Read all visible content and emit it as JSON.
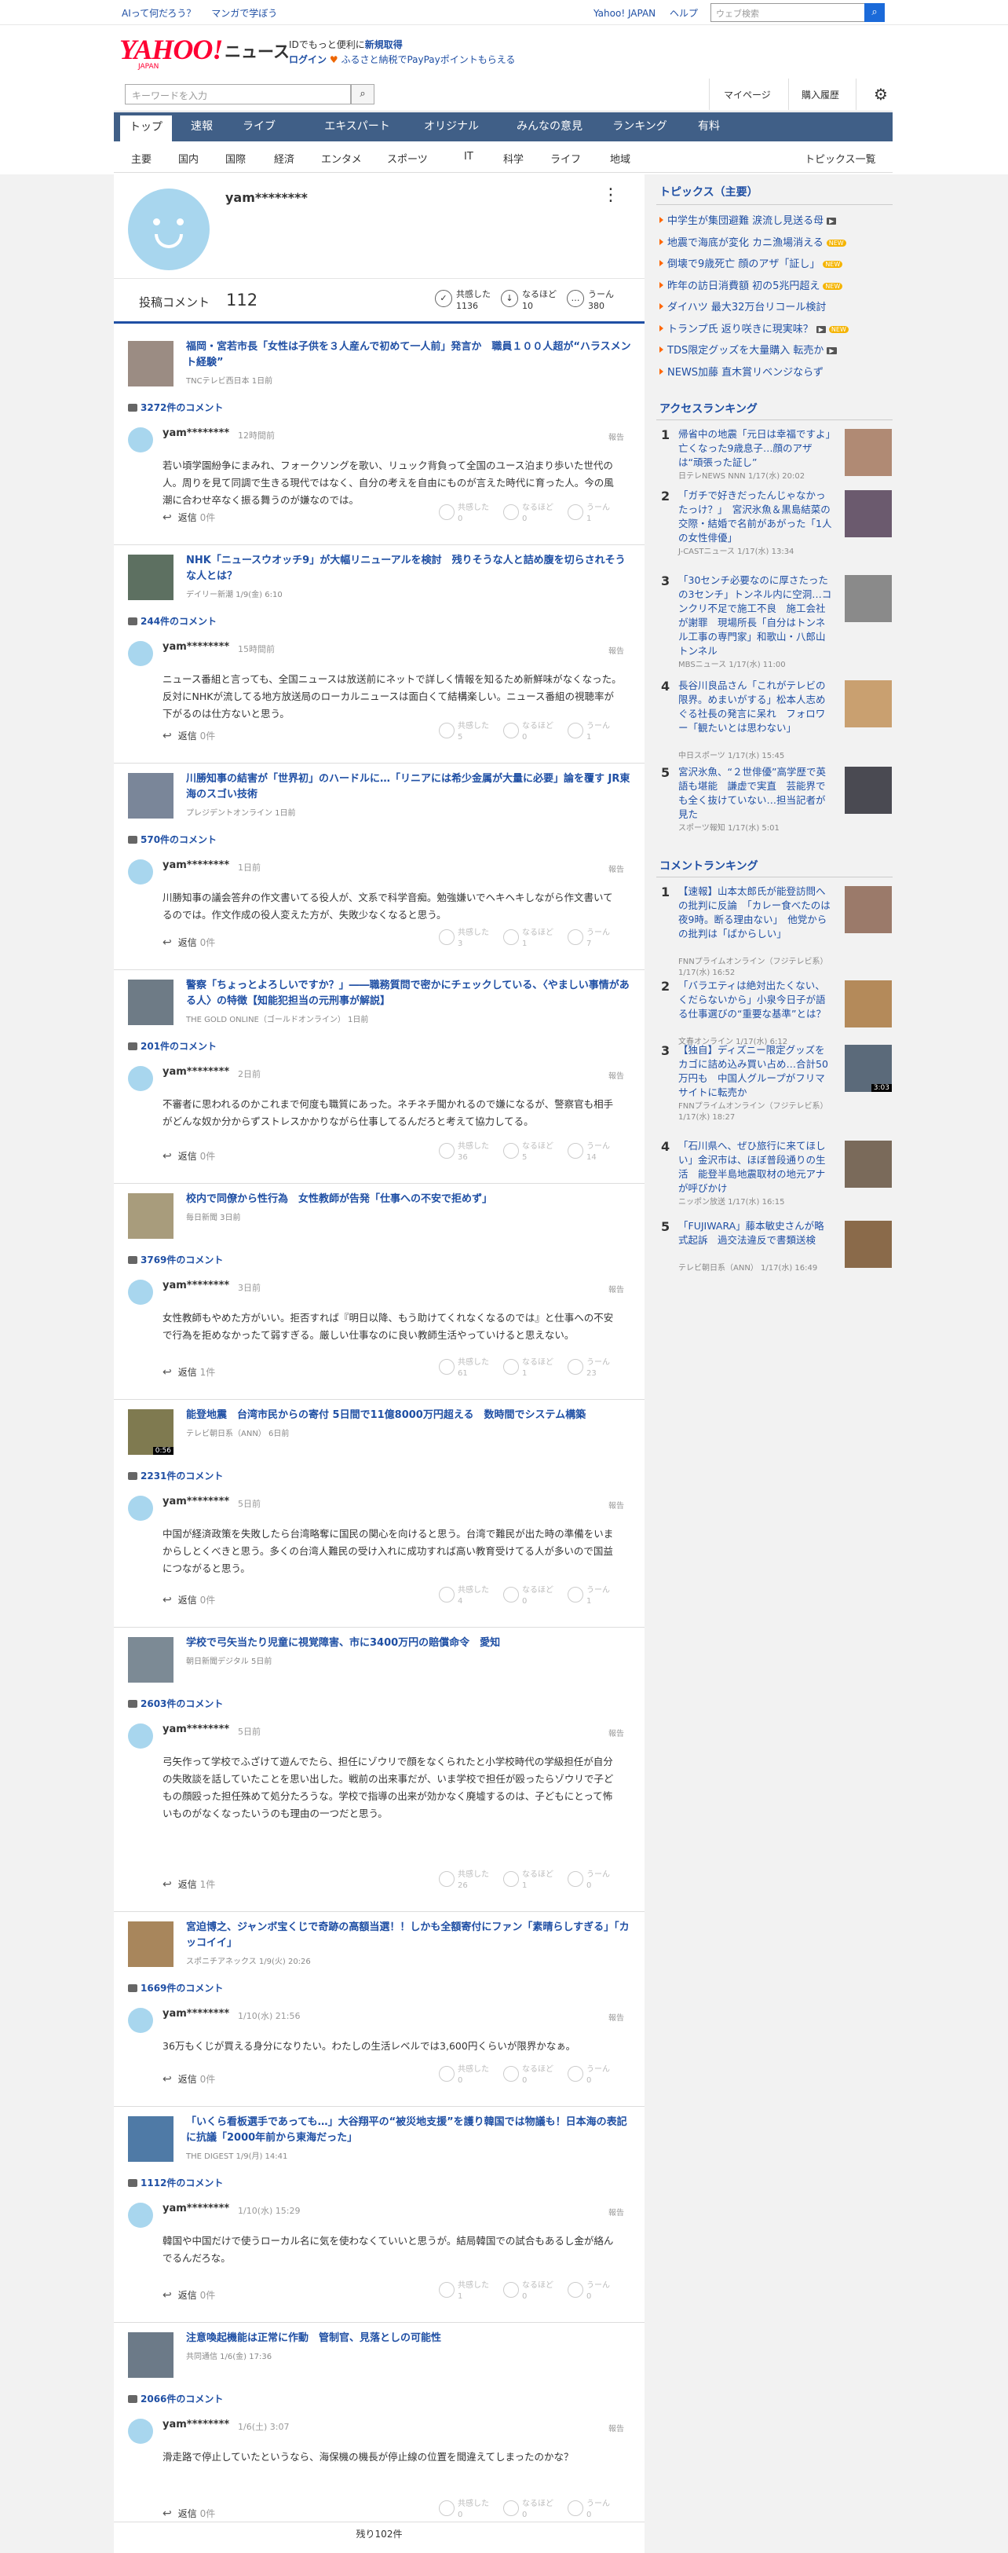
{
  "topbar": {
    "links": [
      "AIって何だろう？",
      "マンガで学ぼう"
    ],
    "right": [
      "Yahoo! JAPAN",
      "ヘルプ"
    ],
    "search_placeholder": "ウェブ検索"
  },
  "header": {
    "logo": "YAHOO!",
    "logo_sub": "JAPAN",
    "title": "ニュース",
    "promo_line1_a": "IDでもっと便利に",
    "promo_line1_b": "新規取得",
    "promo_line2_a": "ログイン",
    "promo_line2_b": "ふるさと納税でPayPayポイントもらえる"
  },
  "search": {
    "placeholder": "キーワードを入力",
    "mypage": "マイページ",
    "purchase": "購入履歴"
  },
  "nav": [
    "トップ",
    "速報",
    "ライブ",
    "エキスパート",
    "オリジナル",
    "みんなの意見",
    "ランキング",
    "有料"
  ],
  "subnav": [
    "主要",
    "国内",
    "国際",
    "経済",
    "エンタメ",
    "スポーツ",
    "IT",
    "科学",
    "ライフ",
    "地域"
  ],
  "subnav_right": "トピックス一覧",
  "profile": {
    "username": "yam********",
    "stat_label": "投稿コメント",
    "stat_count": "112",
    "reactions": [
      {
        "label": "共感した",
        "count": "1136",
        "icon": "✓"
      },
      {
        "label": "なるほど",
        "count": "10",
        "icon": "↓"
      },
      {
        "label": "うーん",
        "count": "380",
        "icon": "…"
      }
    ]
  },
  "comments": [
    {
      "title": "福岡・宮若市長「女性は子供を３人産んで初めて一人前」発言か　職員１００人超が“ハラスメント経験”",
      "source": "TNCテレビ西日本 1日前",
      "count": "3272件のコメント",
      "user": "yam********",
      "time": "12時間前",
      "report": "報告",
      "text": "若い頃学園紛争にまみれ、フォークソングを歌い、リュック背負って全国のユース泊まり歩いた世代の人。周りを見て同調で生きる現代ではなく、自分の考えを自由にものが言えた時代に育った人。今の風潮に合わせ卒なく振る舞うのが嫌なのでは。",
      "reply": "返信",
      "reply_n": "0件",
      "r1": "共感した",
      "n1": "0",
      "r2": "なるほど",
      "n2": "0",
      "r3": "うーん",
      "n3": "1"
    },
    {
      "title": "NHK「ニュースウオッチ9」が大幅リニューアルを検討　残りそうな人と詰め腹を切らされそうな人とは？",
      "source": "デイリー新潮 1/9(金) 6:10",
      "count": "244件のコメント",
      "user": "yam********",
      "time": "15時間前",
      "report": "報告",
      "text": "ニュース番組と言っても、全国ニュースは放送前にネットで詳しく情報を知るため新鮮味がなくなった。反対にNHKが流してる地方放送局のローカルニュースは面白くて結構楽しい。ニュース番組の視聴率が下がるのは仕方ないと思う。",
      "reply": "返信",
      "reply_n": "0件",
      "r1": "共感した",
      "n1": "5",
      "r2": "なるほど",
      "n2": "0",
      "r3": "うーん",
      "n3": "1"
    },
    {
      "title": "川勝知事の結害が「世界初」のハードルに…「リニアには希少金属が大量に必要」論を覆す JR東海のスゴい技術",
      "source": "プレジデントオンライン 1日前",
      "count": "570件のコメント",
      "user": "yam********",
      "time": "1日前",
      "report": "報告",
      "text": "川勝知事の議会答弁の作文書いてる役人が、文系で科学音痴。勉強嫌いでヘキヘキしながら作文書いてるのでは。作文作成の役人変えた方が、失敗少なくなると思う。",
      "reply": "返信",
      "reply_n": "0件",
      "r1": "共感した",
      "n1": "3",
      "r2": "なるほど",
      "n2": "1",
      "r3": "うーん",
      "n3": "7"
    },
    {
      "title": "警察「ちょっとよろしいですか？」――職務質問で密かにチェックしている、〈やましい事情がある人〉の特徴【知能犯担当の元刑事が解説】",
      "source": "THE GOLD ONLINE（ゴールドオンライン） 1日前",
      "count": "201件のコメント",
      "user": "yam********",
      "time": "2日前",
      "report": "報告",
      "text": "不審者に思われるのかこれまで何度も職質にあった。ネチネチ聞かれるので嫌になるが、警察官も相手がどんな奴か分からずストレスかかりながら仕事してるんだろと考えて協力してる。",
      "reply": "返信",
      "reply_n": "0件",
      "r1": "共感した",
      "n1": "36",
      "r2": "なるほど",
      "n2": "5",
      "r3": "うーん",
      "n3": "14"
    },
    {
      "title": "校内で同僚から性行為　女性教師が告発「仕事への不安で拒めず」",
      "source": "毎日新聞 3日前",
      "count": "3769件のコメント",
      "user": "yam********",
      "time": "3日前",
      "report": "報告",
      "text": "女性教師もやめた方がいい。拒否すれば『明日以降、もう助けてくれなくなるのでは』と仕事への不安で行為を拒めなかったて弱すぎる。厳しい仕事なのに良い教師生活やっていけると思えない。",
      "reply": "返信",
      "reply_n": "1件",
      "r1": "共感した",
      "n1": "61",
      "r2": "なるほど",
      "n2": "1",
      "r3": "うーん",
      "n3": "23"
    },
    {
      "title": "能登地震　台湾市民からの寄付 5日間で11億8000万円超える　数時間でシステム構築",
      "source": "テレビ朝日系（ANN） 6日前",
      "count": "2231件のコメント",
      "user": "yam********",
      "time": "5日前",
      "report": "報告",
      "text": "中国が経済政策を失敗したら台湾略奪に国民の関心を向けると思う。台湾で難民が出た時の準備をいまからしとくべきと思う。多くの台湾人難民の受け入れに成功すれば高い教育受けてる人が多いので国益につながると思う。",
      "reply": "返信",
      "reply_n": "0件",
      "r1": "共感した",
      "n1": "4",
      "r2": "なるほど",
      "n2": "0",
      "r3": "うーん",
      "n3": "1",
      "video": "0:56"
    },
    {
      "title": "学校で弓矢当たり児童に視覚障害、市に3400万円の賠償命令　愛知",
      "source": "朝日新聞デジタル 5日前",
      "count": "2603件のコメント",
      "user": "yam********",
      "time": "5日前",
      "report": "報告",
      "text": "弓矢作って学校でふざけて遊んでたら、担任にゾウリで顔をなくられたと小学校時代の学級担任が自分の失敗談を話していたことを思い出した。戦前の出来事だが、いま学校で担任が殴ったらゾウリで子どもの顔殴った担任殊めて処分たろうな。学校で指導の出来が効かなく廃墟するのは、子どもにとって怖いものがなくなったいうのも理由の一つだと思う。",
      "reply": "返信",
      "reply_n": "1件",
      "r1": "共感した",
      "n1": "26",
      "r2": "なるほど",
      "n2": "1",
      "r3": "うーん",
      "n3": "0"
    },
    {
      "title": "宮迫博之、ジャンボ宝くじで奇跡の高額当選！！しかも全額寄付にファン「素晴らしすぎる」「カッコイイ」",
      "source": "スポニチアネックス 1/9(火) 20:26",
      "count": "1669件のコメント",
      "user": "yam********",
      "time": "1/10(水) 21:56",
      "report": "報告",
      "text": "36万もくじが買える身分になりたい。わたしの生活レベルでは3,600円くらいが限界かなぁ。",
      "reply": "返信",
      "reply_n": "0件",
      "r1": "共感した",
      "n1": "0",
      "r2": "なるほど",
      "n2": "0",
      "r3": "うーん",
      "n3": "0"
    },
    {
      "title": "「いくら看板選手であっても…」大谷翔平の“被災地支援”を護り韓国では物議も！日本海の表記に抗議「2000年前から東海だった」",
      "source": "THE DIGEST 1/9(月) 14:41",
      "count": "1112件のコメント",
      "user": "yam********",
      "time": "1/10(水) 15:29",
      "report": "報告",
      "text": "韓国や中国だけで使うローカル名に気を使わなくていいと思うが。結局韓国での試合もあるし金が絡んでるんだろな。",
      "reply": "返信",
      "reply_n": "0件",
      "r1": "共感した",
      "n1": "1",
      "r2": "なるほど",
      "n2": "0",
      "r3": "うーん",
      "n3": "0"
    },
    {
      "title": "注意喚起機能は正常に作動　管制官、見落としの可能性",
      "source": "共同通信 1/6(金) 17:36",
      "count": "2066件のコメント",
      "user": "yam********",
      "time": "1/6(土) 3:07",
      "report": "報告",
      "text": "滑走路で停止していたというなら、海保機の機長が停止線の位置を間違えてしまったのかな？",
      "reply": "返信",
      "reply_n": "0件",
      "r1": "共感した",
      "n1": "0",
      "r2": "なるほど",
      "n2": "0",
      "r3": "うーん",
      "n3": "0"
    }
  ],
  "remaining": "残り102件",
  "topics": {
    "heading": "トピックス（主要）",
    "items": [
      {
        "text": "中学生が集団避難 涙流し見送る母",
        "tag": "cam"
      },
      {
        "text": "地震で海底が変化 カニ漁場消える",
        "tag": "NEW"
      },
      {
        "text": "倒壊で9歳死亡 顔のアザ「証し」",
        "tag": "NEW"
      },
      {
        "text": "昨年の訪日消費額 初の5兆円超え",
        "tag": "NEW"
      },
      {
        "text": "ダイハツ 最大32万台リコール検討",
        "tag": ""
      },
      {
        "text": "トランプ氏 返り咲きに現実味？",
        "tag": "cam2"
      },
      {
        "text": "TDS限定グッズを大量購入 転売か",
        "tag": "cam"
      },
      {
        "text": "NEWS加藤 直木賞リベンジならず",
        "tag": ""
      }
    ]
  },
  "access": {
    "heading": "アクセスランキング",
    "items": [
      {
        "n": "1",
        "title": "帰省中の地震「元日は幸福ですよ」　亡くなった9歳息子…顔のアザは“頑張った証し”",
        "src": "日テレNEWS NNN 1/17(水) 20:02"
      },
      {
        "n": "2",
        "title": "「ガチで好きだったんじゃなかったっけ？」　宮沢氷魚＆黒島結菜の交際・結婚で名前があがった「1人の女性俳優」",
        "src": "J-CASTニュース 1/17(水) 13:34"
      },
      {
        "n": "3",
        "title": "「30センチ必要なのに厚さたったの3センチ」トンネル内に空洞…コンクリ不足で施工不良　施工会社が謝罪　現場所長「自分はトンネル工事の専門家」和歌山・八郎山トンネル",
        "src": "MBSニュース 1/17(水) 11:00"
      },
      {
        "n": "4",
        "title": "長谷川良品さん「これがテレビの限界。めまいがする」松本人志めぐる社長の発言に呆れ　フォロワー「観たいとは思わない」",
        "src": "中日スポーツ 1/17(水) 15:45"
      },
      {
        "n": "5",
        "title": "宮沢氷魚、“２世俳優”高学歴で英語も堪能　謙虚で実直　芸能界でも全く抜けていない…担当記者が見た",
        "src": "スポーツ報知 1/17(水) 5:01"
      }
    ]
  },
  "commentrank": {
    "heading": "コメントランキング",
    "items": [
      {
        "n": "1",
        "title": "【速報】山本太郎氏が能登訪問への批判に反論　「カレー食べたのは夜9時。断る理由ない」　他党からの批判は「ばからしい」",
        "src": "FNNプライムオンライン（フジテレビ系） 1/17(水) 16:52"
      },
      {
        "n": "2",
        "title": "「バラエティは絶対出たくない、くだらないから」小泉今日子が語る仕事選びの“重要な基準”とは？",
        "src": "文春オンライン 1/17(水) 6:12"
      },
      {
        "n": "3",
        "title": "【独自】ディズニー限定グッズをカゴに詰め込み買い占め…合計50万円も　中国人グループがフリマサイトに転売か",
        "src": "FNNプライムオンライン（フジテレビ系） 1/17(水) 18:27",
        "video": "3:03"
      },
      {
        "n": "4",
        "title": "「石川県へ、ぜひ旅行に来てほしい」金沢市は、ほぼ普段通りの生活　能登半島地震取材の地元アナが呼びかけ",
        "src": "ニッポン放送 1/17(水) 16:15"
      },
      {
        "n": "5",
        "title": "「FUJIWARA」藤本敏史さんが略式起訴　過交法違反で書類送検",
        "src": "テレビ朝日系（ANN） 1/17(水) 16:49"
      }
    ]
  },
  "colors": {
    "brand": "#ff0033",
    "link": "#1f4fa4",
    "nav": "#405f87",
    "avatar": "#a8d6ee",
    "new_tag": "#f5b400"
  }
}
